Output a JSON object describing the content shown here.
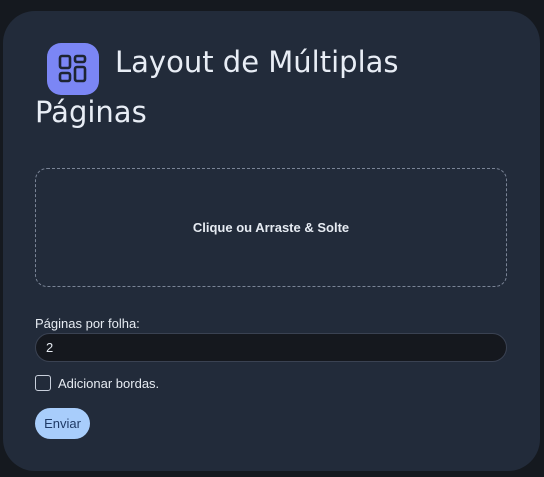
{
  "header": {
    "title": "Layout de Múltiplas Páginas",
    "icon": "grid-layout-icon"
  },
  "upload": {
    "label": "Clique ou Arraste & Solte"
  },
  "form": {
    "pages_label": "Páginas por folha:",
    "pages_value": "2",
    "borders_label": "Adicionar bordas.",
    "borders_checked": false,
    "submit_label": "Enviar"
  },
  "colors": {
    "accent": "#7b86f5",
    "button": "#a8cdfb",
    "card_bg": "#222b3a",
    "page_bg": "#15191f"
  }
}
